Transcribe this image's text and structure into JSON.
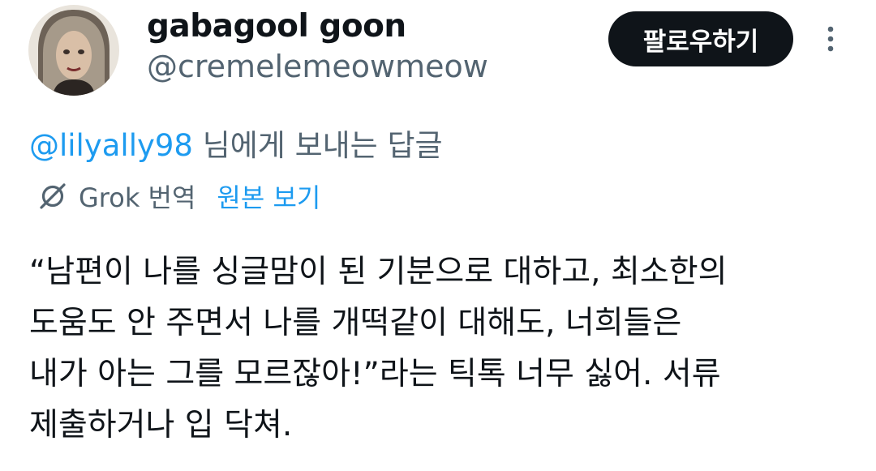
{
  "author": {
    "display_name": "gabagool goon",
    "handle": "@cremelemeowmeow",
    "avatar_icon": "profile-photo"
  },
  "actions": {
    "follow_label": "팔로우하기",
    "more_icon": "more-vertical-icon"
  },
  "reply_context": {
    "mention": "@lilyally98",
    "suffix": " 님에게 보내는 답글"
  },
  "translation": {
    "icon": "grok-icon",
    "label": "Grok 번역",
    "show_original": "원본 보기"
  },
  "tweet": {
    "lines": [
      "“남편이 나를 싱글맘이 된 기분으로 대하고, 최소한의",
      "도움도 안 주면서 나를 개떡같이 대해도, 너희들은",
      "내가 아는 그를 모르잖아!”라는 틱톡 너무 싫어. 서류",
      "제출하거나 입 닥쳐."
    ]
  },
  "colors": {
    "text": "#0f1419",
    "secondary": "#536471",
    "link": "#1d9bf0",
    "button_bg": "#0f1419"
  }
}
